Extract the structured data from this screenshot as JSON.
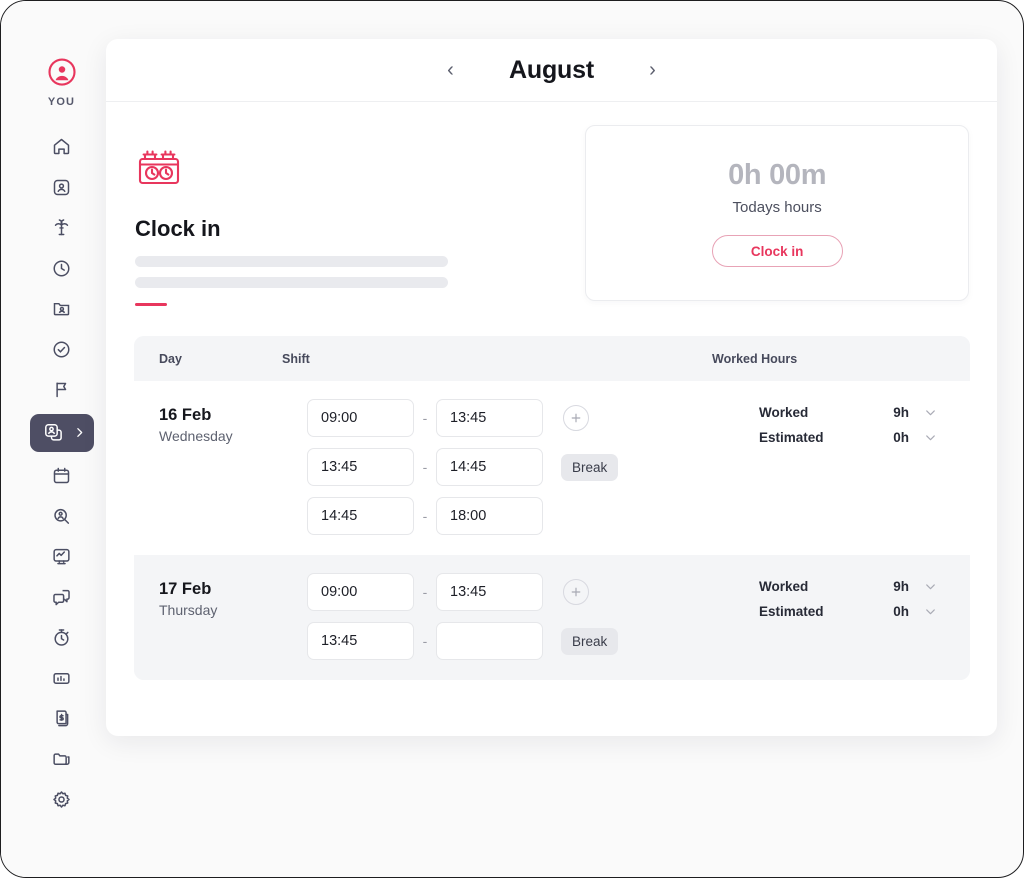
{
  "sidebar": {
    "avatar_icon": "user-circle-icon",
    "you_label": "YOU",
    "accent_color": "#e8365d",
    "active_color": "#4e4e64",
    "items": [
      {
        "icon": "home-icon",
        "name": "home"
      },
      {
        "icon": "profile-icon",
        "name": "profile"
      },
      {
        "icon": "palm-tree-icon",
        "name": "time-off"
      },
      {
        "icon": "clock-icon",
        "name": "attendance"
      },
      {
        "icon": "id-card-icon",
        "name": "documents"
      },
      {
        "icon": "check-circle-icon",
        "name": "tasks"
      },
      {
        "icon": "flag-icon",
        "name": "goals"
      },
      {
        "icon": "people-stack-icon",
        "name": "team",
        "active": true,
        "chevron": "chevron-right-icon"
      },
      {
        "icon": "calendar-icon",
        "name": "calendar"
      },
      {
        "icon": "search-person-icon",
        "name": "recruiting"
      },
      {
        "icon": "performance-icon",
        "name": "performance"
      },
      {
        "icon": "chat-icon",
        "name": "messages"
      },
      {
        "icon": "stopwatch-icon",
        "name": "time-tracking"
      },
      {
        "icon": "bar-chart-icon",
        "name": "reports"
      },
      {
        "icon": "payslip-icon",
        "name": "payroll"
      },
      {
        "icon": "folder-icon",
        "name": "files"
      },
      {
        "icon": "gear-icon",
        "name": "settings"
      }
    ]
  },
  "header": {
    "prev_label": "‹",
    "title": "August",
    "next_label": "›"
  },
  "clock_in_panel": {
    "icon": "time-clock-icon",
    "title": "Clock in"
  },
  "hours_card": {
    "value": "0h 00m",
    "label": "Todays hours",
    "button_label": "Clock in"
  },
  "table": {
    "columns": {
      "day": "Day",
      "shift": "Shift",
      "worked_hours": "Worked Hours"
    },
    "rows": [
      {
        "date": "16 Feb",
        "weekday": "Wednesday",
        "shifts": [
          {
            "start": "09:00",
            "end": "13:45",
            "separator": "-",
            "action": "add",
            "action_label": "+"
          },
          {
            "start": "13:45",
            "end": "14:45",
            "separator": "-",
            "action": "break",
            "action_label": "Break"
          },
          {
            "start": "14:45",
            "end": "18:00",
            "separator": "-",
            "action": "none",
            "action_label": ""
          }
        ],
        "totals": [
          {
            "label": "Worked",
            "value": "9h"
          },
          {
            "label": "Estimated",
            "value": "0h"
          }
        ]
      },
      {
        "date": "17 Feb",
        "weekday": "Thursday",
        "shifts": [
          {
            "start": "09:00",
            "end": "13:45",
            "separator": "-",
            "action": "add",
            "action_label": "+"
          },
          {
            "start": "13:45",
            "end": "",
            "separator": "-",
            "action": "break",
            "action_label": "Break"
          }
        ],
        "totals": [
          {
            "label": "Worked",
            "value": "9h"
          },
          {
            "label": "Estimated",
            "value": "0h"
          }
        ]
      }
    ]
  }
}
